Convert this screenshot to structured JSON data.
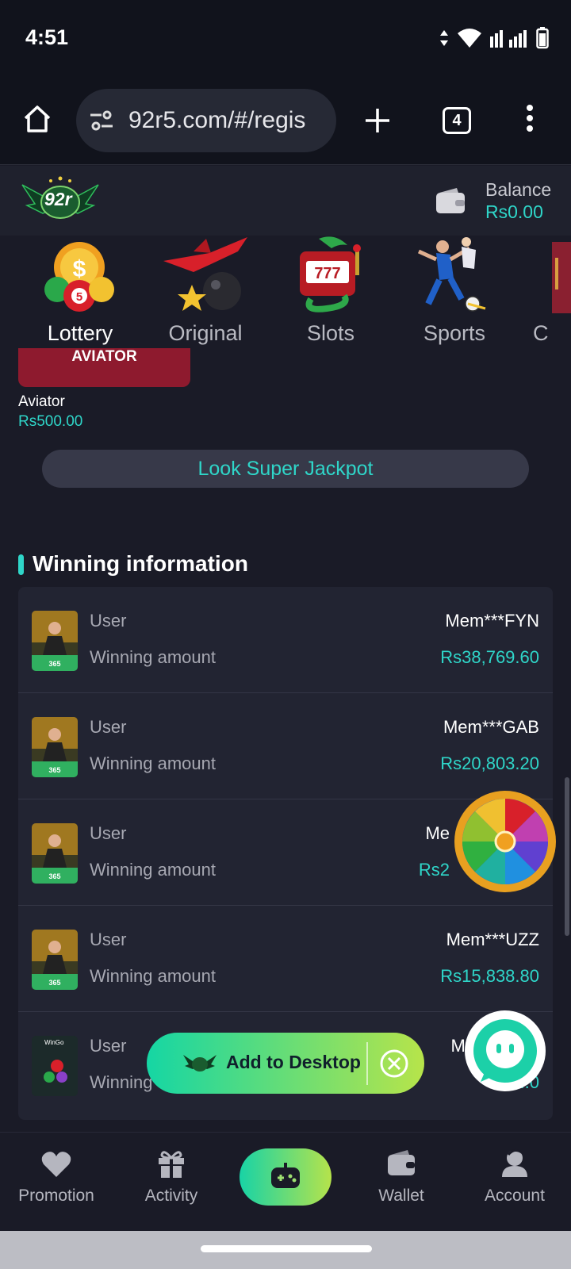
{
  "status": {
    "time": "4:51"
  },
  "browser": {
    "url": "92r5.com/#/regis",
    "tab_count": "4"
  },
  "header": {
    "logo_text": "92r",
    "balance_label": "Balance",
    "balance_value": "Rs0.00"
  },
  "categories": [
    {
      "label": "Lottery",
      "active": true
    },
    {
      "label": "Original",
      "active": false
    },
    {
      "label": "Slots",
      "active": false
    },
    {
      "label": "Sports",
      "active": false
    },
    {
      "label": "C",
      "active": false
    }
  ],
  "aviator": {
    "banner": "AVIATOR",
    "name": "Aviator",
    "price": "Rs500.00"
  },
  "jackpot_button": "Look Super Jackpot",
  "winning": {
    "title": "Winning information",
    "user_label": "User",
    "amount_label": "Winning amount",
    "rows": [
      {
        "user": "Mem***FYN",
        "amount": "Rs38,769.60"
      },
      {
        "user": "Mem***GAB",
        "amount": "Rs20,803.20"
      },
      {
        "user": "Me",
        "amount": "Rs2"
      },
      {
        "user": "Mem***UZZ",
        "amount": "Rs15,838.80"
      },
      {
        "user": "Me",
        "amount": "R...0"
      }
    ],
    "last_row_amount_label": "Winning"
  },
  "add_desktop": {
    "label": "Add to Desktop"
  },
  "wingo_thumb_text": "WinGo",
  "nav": {
    "promotion": "Promotion",
    "activity": "Activity",
    "wallet": "Wallet",
    "account": "Account"
  },
  "colors": {
    "accent": "#2fd6c9",
    "background": "#1a1b27",
    "card": "#222432"
  }
}
